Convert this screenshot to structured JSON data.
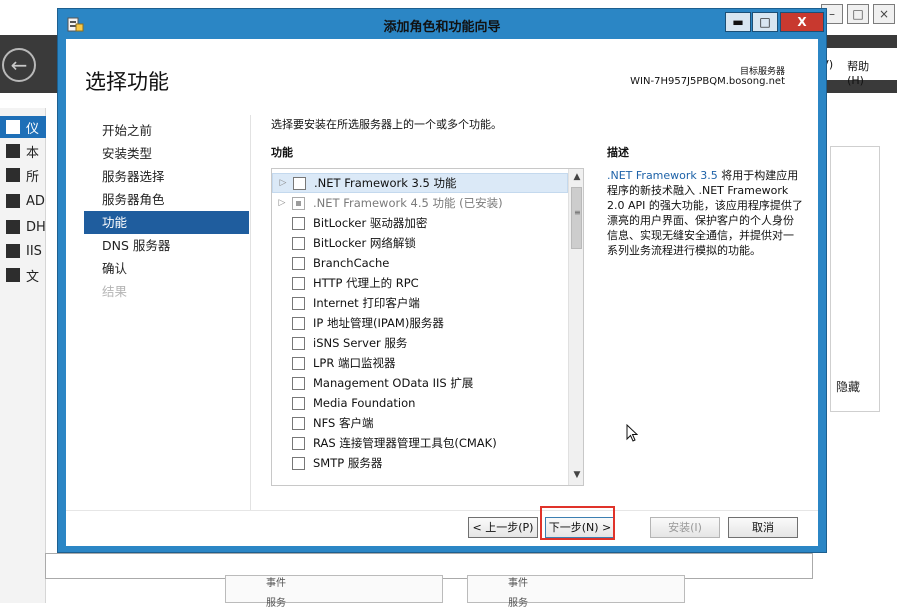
{
  "background": {
    "menu": [
      "(V)",
      "帮助(H)"
    ],
    "sidebar_items": [
      {
        "label": "仪",
        "active": true
      },
      {
        "label": "本"
      },
      {
        "label": "所"
      },
      {
        "label": "AD"
      },
      {
        "label": "DH"
      },
      {
        "label": "IIS"
      },
      {
        "label": "文"
      }
    ],
    "hide_label": "隐藏",
    "lower_labels": [
      "事件",
      "服务"
    ]
  },
  "window": {
    "title": "添加角色和功能向导",
    "min": "▬",
    "max": "□",
    "close": "X"
  },
  "header": {
    "page_title": "选择功能",
    "dest_label": "目标服务器",
    "dest_server": "WIN-7H957J5PBQM.bosong.net"
  },
  "steps": [
    {
      "label": "开始之前"
    },
    {
      "label": "安装类型"
    },
    {
      "label": "服务器选择"
    },
    {
      "label": "服务器角色"
    },
    {
      "label": "功能",
      "active": true
    },
    {
      "label": "DNS 服务器"
    },
    {
      "label": "确认"
    },
    {
      "label": "结果",
      "disabled": true
    }
  ],
  "main": {
    "instruction": "选择要安装在所选服务器上的一个或多个功能。",
    "features_header": "功能",
    "description_header": "描述",
    "features": [
      {
        "label": ".NET Framework 3.5 功能",
        "expandable": true,
        "selected": true
      },
      {
        "label": ".NET Framework 4.5 功能 (已安装)",
        "expandable": true,
        "indeterminate": true,
        "dim": true
      },
      {
        "label": "BitLocker 驱动器加密"
      },
      {
        "label": "BitLocker 网络解锁"
      },
      {
        "label": "BranchCache"
      },
      {
        "label": "HTTP 代理上的 RPC"
      },
      {
        "label": "Internet 打印客户端"
      },
      {
        "label": "IP 地址管理(IPAM)服务器"
      },
      {
        "label": "iSNS Server 服务"
      },
      {
        "label": "LPR 端口监视器"
      },
      {
        "label": "Management OData IIS 扩展"
      },
      {
        "label": "Media Foundation"
      },
      {
        "label": "NFS 客户端"
      },
      {
        "label": "RAS 连接管理器管理工具包(CMAK)"
      },
      {
        "label": "SMTP 服务器"
      }
    ],
    "description_link": ".NET Framework 3.5",
    "description_body": " 将用于构建应用程序的新技术融入 .NET Framework 2.0 API 的强大功能，该应用程序提供了漂亮的用户界面、保护客户的个人身份信息、实现无缝安全通信，并提供对一系列业务流程进行模拟的功能。"
  },
  "buttons": {
    "prev": "< 上一步(P)",
    "next": "下一步(N) >",
    "install": "安装(I)",
    "cancel": "取消"
  },
  "colors": {
    "title_bar": "#2b86c5",
    "active_step": "#1f5d9e",
    "highlight_box": "#e0332a"
  }
}
